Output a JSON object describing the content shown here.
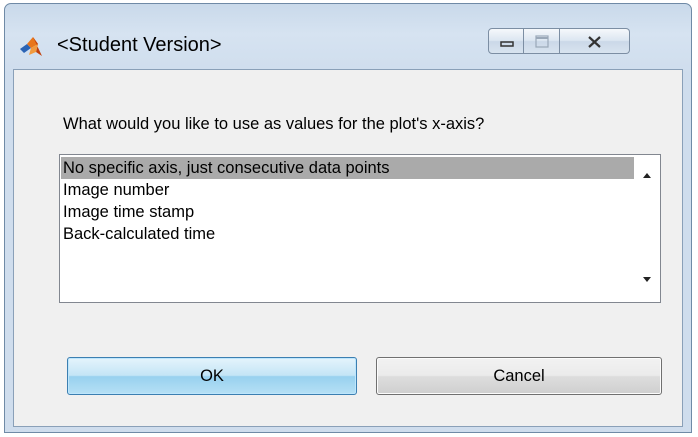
{
  "window": {
    "title": "<Student Version>",
    "icon": "matlab-logo-icon",
    "caption_buttons": [
      "minimize-icon",
      "maximize-icon",
      "close-icon"
    ]
  },
  "dialog": {
    "prompt": "What would you like to use as values for the plot's x-axis?",
    "options": [
      "No specific axis, just consecutive data points",
      "Image number",
      "Image time stamp",
      "Back-calculated time"
    ],
    "selected_option": "No specific axis, just consecutive data points",
    "ok_label": "OK",
    "cancel_label": "Cancel"
  },
  "colors": {
    "selection": "#aaaaaa",
    "frame": "#cfdded"
  }
}
